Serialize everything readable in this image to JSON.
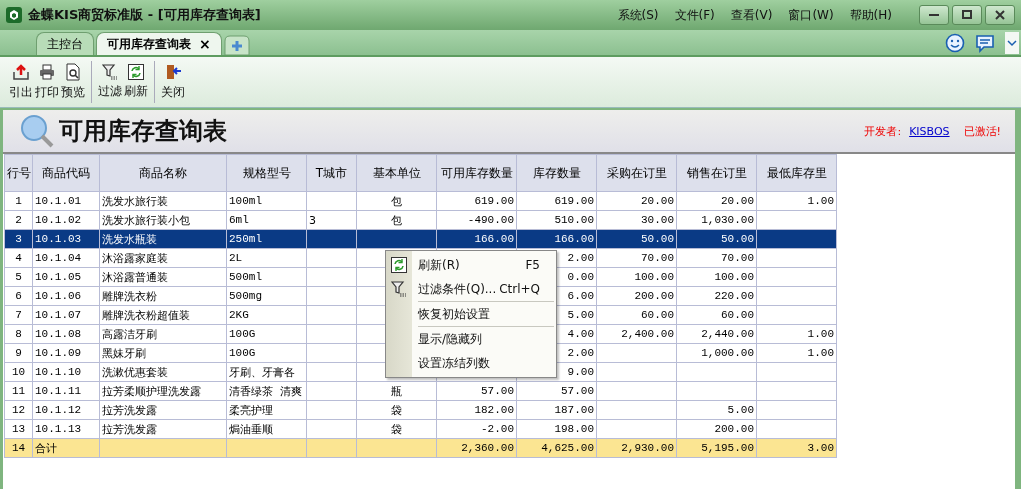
{
  "window": {
    "title": "金蝶KIS商贸标准版 - [可用库存查询表]"
  },
  "menu": [
    "系统(S)",
    "文件(F)",
    "查看(V)",
    "窗口(W)",
    "帮助(H)"
  ],
  "tabs": [
    {
      "label": "主控台",
      "selected": false
    },
    {
      "label": "可用库存查询表",
      "selected": true,
      "close": "×"
    }
  ],
  "toolbar": [
    {
      "label": "引出"
    },
    {
      "label": "打印"
    },
    {
      "label": "预览"
    },
    {
      "label": "过滤"
    },
    {
      "label": "刷新"
    },
    {
      "label": "关闭"
    }
  ],
  "report": {
    "title": "可用库存查询表",
    "developer_label": "开发者:",
    "developer_link": "KISBOS",
    "status": "已激活!"
  },
  "table": {
    "columns": [
      "行号",
      "商品代码",
      "商品名称",
      "规格型号",
      "T城市",
      "基本单位",
      "可用库存数量",
      "库存数量",
      "采购在订里",
      "销售在订里",
      "最低库存里"
    ],
    "rows": [
      {
        "selected": false,
        "kind": "item",
        "cells": [
          "1",
          "10.1.01",
          "洗发水旅行装",
          "100ml",
          null,
          "包",
          "619.00",
          "619.00",
          "20.00",
          "20.00",
          "1.00"
        ]
      },
      {
        "selected": false,
        "kind": "item",
        "cells": [
          "2",
          "10.1.02",
          "洗发水旅行装小包",
          "6ml",
          "3",
          "包",
          "-490.00",
          "510.00",
          "30.00",
          "1,030.00",
          null
        ]
      },
      {
        "selected": true,
        "kind": "item",
        "cells": [
          "3",
          "10.1.03",
          "洗发水瓶装",
          "250ml",
          null,
          null,
          "166.00",
          "166.00",
          "50.00",
          "50.00",
          null
        ]
      },
      {
        "selected": false,
        "kind": "item",
        "cells": [
          "4",
          "10.1.04",
          "沐浴露家庭装",
          "2L",
          null,
          null,
          null,
          "2.00",
          "70.00",
          "70.00",
          null
        ]
      },
      {
        "selected": false,
        "kind": "item",
        "cells": [
          "5",
          "10.1.05",
          "沐浴露普通装",
          "500ml",
          null,
          null,
          null,
          "0.00",
          "100.00",
          "100.00",
          null
        ]
      },
      {
        "selected": false,
        "kind": "item",
        "cells": [
          "6",
          "10.1.06",
          "雕牌洗衣粉",
          "500mg",
          null,
          null,
          null,
          "6.00",
          "200.00",
          "220.00",
          null
        ]
      },
      {
        "selected": false,
        "kind": "item",
        "cells": [
          "7",
          "10.1.07",
          "雕牌洗衣粉超值装",
          "2KG",
          null,
          null,
          null,
          "5.00",
          "60.00",
          "60.00",
          null
        ]
      },
      {
        "selected": false,
        "kind": "item",
        "cells": [
          "8",
          "10.1.08",
          "高露洁牙刷",
          "100G",
          null,
          null,
          null,
          "4.00",
          "2,400.00",
          "2,440.00",
          "1.00"
        ]
      },
      {
        "selected": false,
        "kind": "item",
        "cells": [
          "9",
          "10.1.09",
          "黑妹牙刷",
          "100G",
          null,
          null,
          null,
          "2.00",
          null,
          "1,000.00",
          "1.00"
        ]
      },
      {
        "selected": false,
        "kind": "item",
        "cells": [
          "10",
          "10.1.10",
          "洗漱优惠套装",
          "牙刷、牙膏各",
          null,
          null,
          null,
          "9.00",
          null,
          null,
          null
        ]
      },
      {
        "selected": false,
        "kind": "item",
        "cells": [
          "11",
          "10.1.11",
          "拉芳柔顺护理洗发露",
          "清香绿茶 清爽",
          null,
          "瓶",
          "57.00",
          "57.00",
          null,
          null,
          null
        ]
      },
      {
        "selected": false,
        "kind": "item",
        "cells": [
          "12",
          "10.1.12",
          "拉芳洗发露",
          "柔亮护理",
          null,
          "袋",
          "182.00",
          "187.00",
          null,
          "5.00",
          null
        ]
      },
      {
        "selected": false,
        "kind": "item",
        "cells": [
          "13",
          "10.1.13",
          "拉芳洗发露",
          "焗油垂顺",
          null,
          "袋",
          "-2.00",
          "198.00",
          null,
          "200.00",
          null
        ]
      },
      {
        "selected": false,
        "kind": "total",
        "cells": [
          "14",
          "合计",
          null,
          null,
          null,
          null,
          "2,360.00",
          "4,625.00",
          "2,930.00",
          "5,195.00",
          "3.00"
        ]
      }
    ]
  },
  "context_menu": [
    {
      "kind": "item",
      "label": "刷新(R)",
      "shortcut": "F5"
    },
    {
      "kind": "item",
      "label": "过滤条件(Q)...",
      "shortcut": "Ctrl+Q"
    },
    {
      "kind": "separator"
    },
    {
      "kind": "item",
      "label": "恢复初始设置"
    },
    {
      "kind": "separator"
    },
    {
      "kind": "item",
      "label": "显示/隐藏列"
    },
    {
      "kind": "item",
      "label": "设置冻结列数"
    }
  ]
}
